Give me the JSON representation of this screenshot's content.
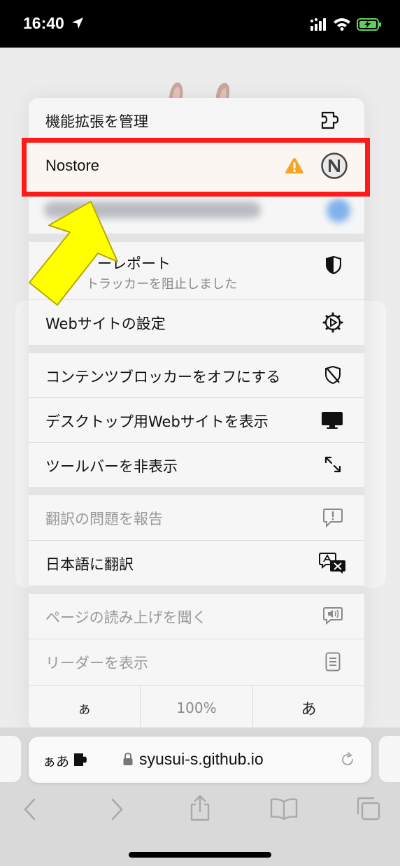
{
  "status_bar": {
    "time": "16:40",
    "icons": [
      "location-arrow-icon",
      "cellular-signal-icon",
      "wifi-icon",
      "battery-charging-icon"
    ]
  },
  "menu": {
    "items": [
      {
        "label": "機能拡張を管理",
        "icon": "extension-manage-icon",
        "enabled": true
      },
      {
        "label": "Nostore",
        "icon": "nostore-icon",
        "warning_icon": "warning-icon",
        "highlighted": true
      },
      {
        "label": "",
        "icon": "blurred-extension-icon",
        "blurred": true
      },
      {
        "label": "プライバシーレポート",
        "visible_label": "ーレポート",
        "sublabel": "トラッカーを阻止しました",
        "icon": "privacy-shield-icon"
      },
      {
        "label": "Webサイトの設定",
        "icon": "website-settings-gear-icon"
      },
      {
        "label": "コンテンツブロッカーをオフにする",
        "icon": "content-blocker-off-icon"
      },
      {
        "label": "デスクトップ用Webサイトを表示",
        "icon": "desktop-monitor-icon"
      },
      {
        "label": "ツールバーを非表示",
        "icon": "hide-toolbar-arrows-icon"
      },
      {
        "label": "翻訳の問題を報告",
        "icon": "report-issue-bubble-icon",
        "enabled": false
      },
      {
        "label": "日本語に翻訳",
        "icon": "translate-icon"
      },
      {
        "label": "ページの読み上げを聞く",
        "icon": "listen-page-speaker-icon",
        "enabled": false
      },
      {
        "label": "リーダーを表示",
        "icon": "reader-document-icon",
        "enabled": false
      }
    ],
    "zoom": {
      "smaller": "ぁ",
      "level": "100%",
      "larger": "あ"
    }
  },
  "address_bar": {
    "aa": "ぁあ",
    "domain": "syusui-s.github.io"
  },
  "toolbar": {
    "buttons": [
      "back-icon",
      "forward-icon",
      "share-icon",
      "bookmarks-icon",
      "tabs-icon"
    ]
  },
  "colors": {
    "highlight_border": "#ff1a1a",
    "arrow_fill": "#ffff00",
    "warning": "#f5a623"
  }
}
